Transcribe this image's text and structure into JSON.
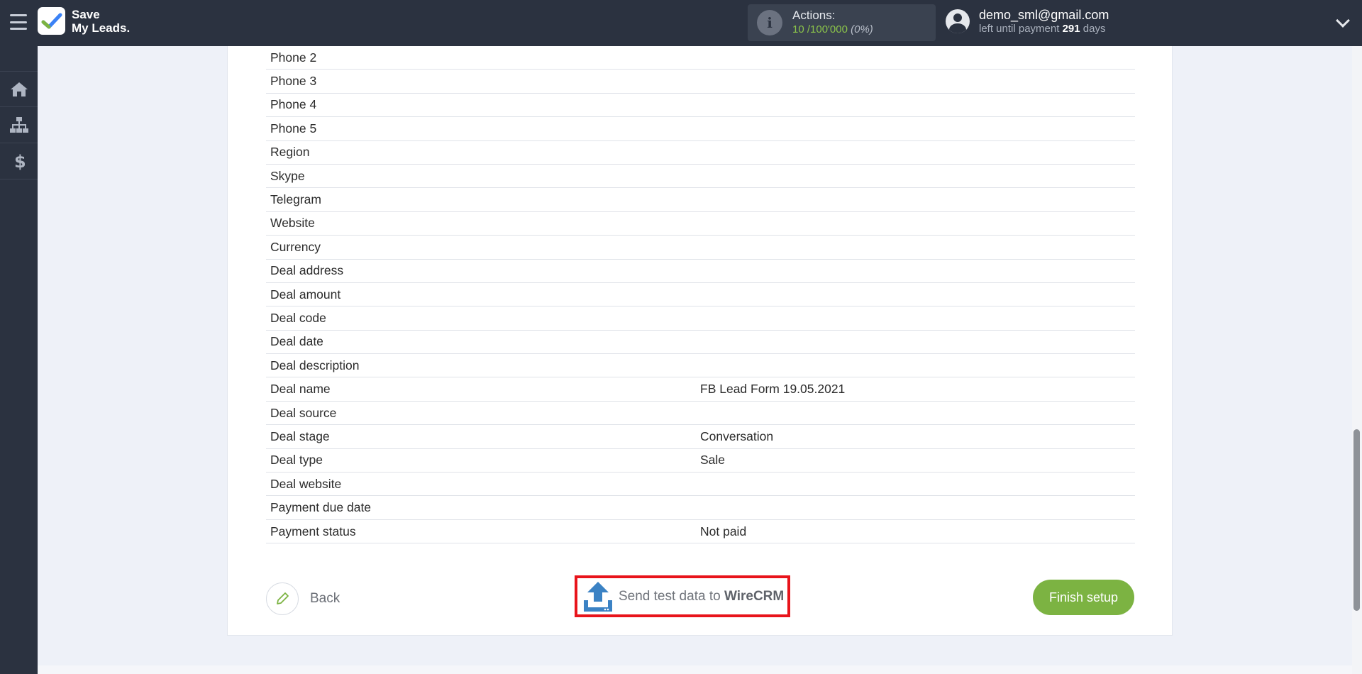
{
  "header": {
    "logo_line1": "Save",
    "logo_line2": "My Leads.",
    "actions_label": "Actions:",
    "actions_used": "10",
    "actions_total": "/100'000",
    "actions_percent": "(0%)",
    "user_email": "demo_sml@gmail.com",
    "payment_prefix": "left until payment",
    "payment_days": "291",
    "payment_suffix": "days"
  },
  "sidebar": {
    "items": [
      {
        "icon": "home-icon"
      },
      {
        "icon": "sitemap-icon"
      },
      {
        "icon": "dollar-icon"
      }
    ]
  },
  "fields": [
    {
      "name": "Phone 2",
      "value": ""
    },
    {
      "name": "Phone 3",
      "value": ""
    },
    {
      "name": "Phone 4",
      "value": ""
    },
    {
      "name": "Phone 5",
      "value": ""
    },
    {
      "name": "Region",
      "value": ""
    },
    {
      "name": "Skype",
      "value": ""
    },
    {
      "name": "Telegram",
      "value": ""
    },
    {
      "name": "Website",
      "value": ""
    },
    {
      "name": "Currency",
      "value": ""
    },
    {
      "name": "Deal address",
      "value": ""
    },
    {
      "name": "Deal amount",
      "value": ""
    },
    {
      "name": "Deal code",
      "value": ""
    },
    {
      "name": "Deal date",
      "value": ""
    },
    {
      "name": "Deal description",
      "value": ""
    },
    {
      "name": "Deal name",
      "value": "FB Lead Form 19.05.2021"
    },
    {
      "name": "Deal source",
      "value": ""
    },
    {
      "name": "Deal stage",
      "value": "Conversation"
    },
    {
      "name": "Deal type",
      "value": "Sale"
    },
    {
      "name": "Deal website",
      "value": ""
    },
    {
      "name": "Payment due date",
      "value": ""
    },
    {
      "name": "Payment status",
      "value": "Not paid"
    }
  ],
  "footer": {
    "back_label": "Back",
    "send_prefix": "Send test data to",
    "send_target": "WireCRM",
    "finish_label": "Finish setup"
  },
  "colors": {
    "accent_green": "#7cb342",
    "highlight_red": "#e8141b",
    "topbar": "#2b3240"
  }
}
